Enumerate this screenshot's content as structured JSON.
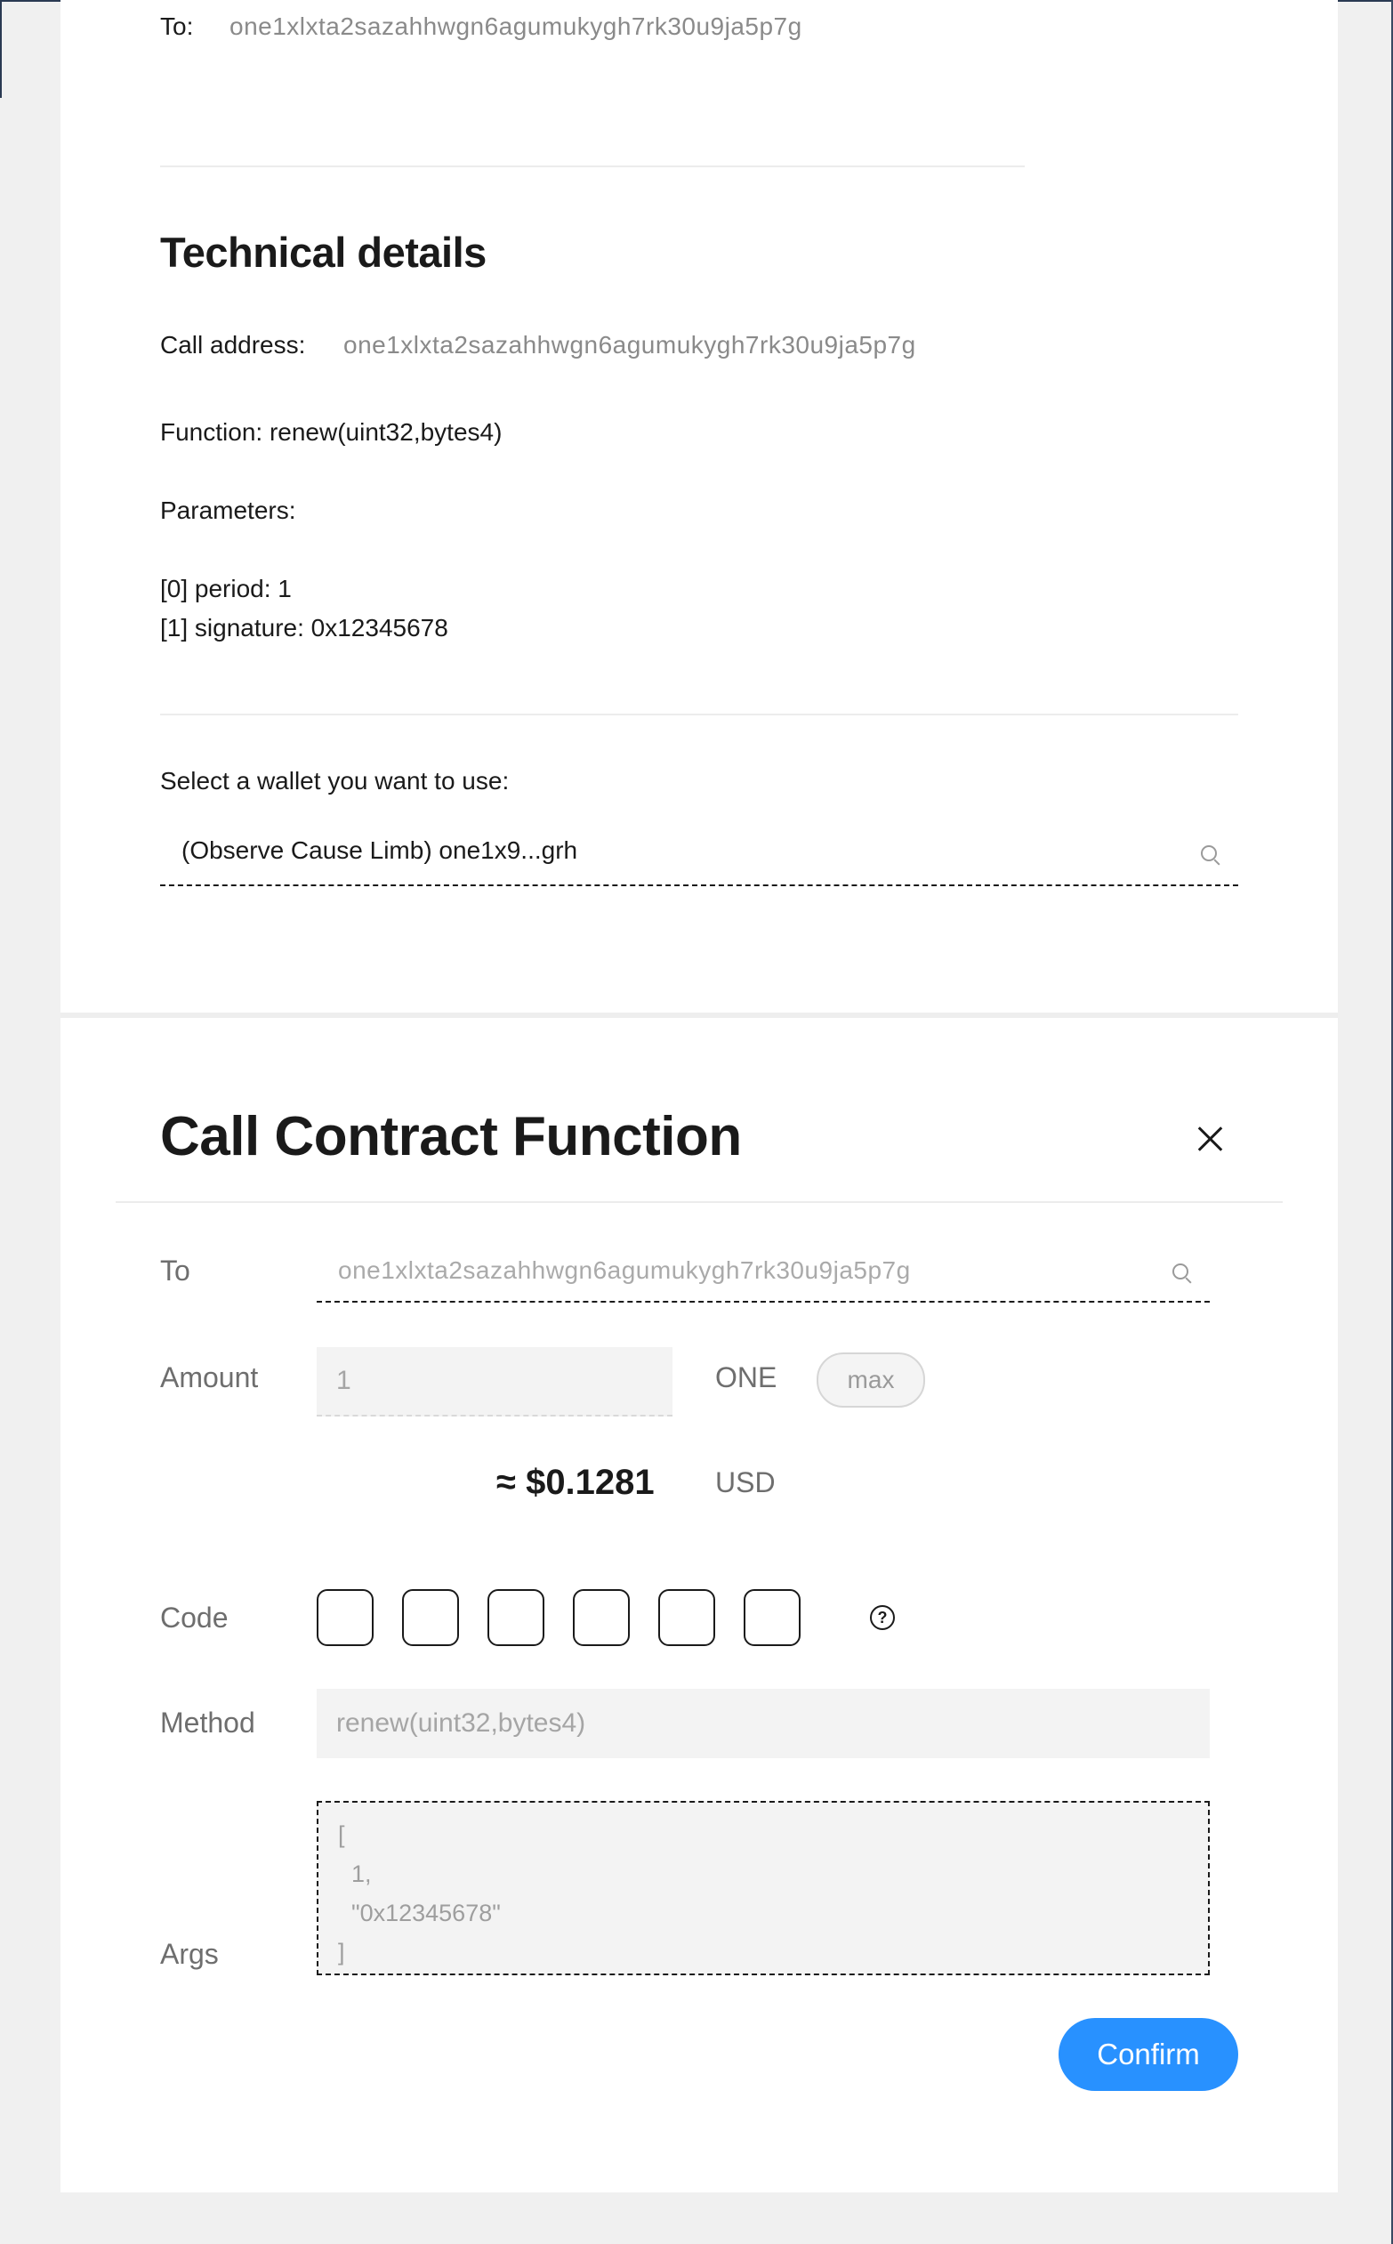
{
  "summary": {
    "to_label": "To:",
    "to_address": "one1xlxta2sazahhwgn6agumukygh7rk30u9ja5p7g"
  },
  "technical_details": {
    "title": "Technical details",
    "call_address_label": "Call address:",
    "call_address": "one1xlxta2sazahhwgn6agumukygh7rk30u9ja5p7g",
    "function_text": "Function: renew(uint32,bytes4)",
    "parameters_label": "Parameters:",
    "parameters": [
      "[0] period: 1",
      "[1] signature: 0x12345678"
    ]
  },
  "wallet_select": {
    "label": "Select a wallet you want to use:",
    "value": "(Observe Cause Limb) one1x9...grh",
    "icon": "search-icon"
  },
  "modal": {
    "title": "Call Contract Function",
    "close_icon": "close-icon",
    "to_label": "To",
    "to_value": "one1xlxta2sazahhwgn6agumukygh7rk30u9ja5p7g",
    "amount_label": "Amount",
    "amount_value": "1",
    "amount_unit": "ONE",
    "max_label": "max",
    "usd_value": "≈ $0.1281",
    "usd_unit": "USD",
    "code_label": "Code",
    "code_digits": [
      "",
      "",
      "",
      "",
      "",
      ""
    ],
    "help_icon": "question-circle-icon",
    "method_label": "Method",
    "method_value": "renew(uint32,bytes4)",
    "args_label": "Args",
    "args_lines": [
      "[",
      "  1,",
      "  \"0x12345678\"",
      "]"
    ],
    "confirm_label": "Confirm",
    "accent_color": "#2891ff"
  }
}
